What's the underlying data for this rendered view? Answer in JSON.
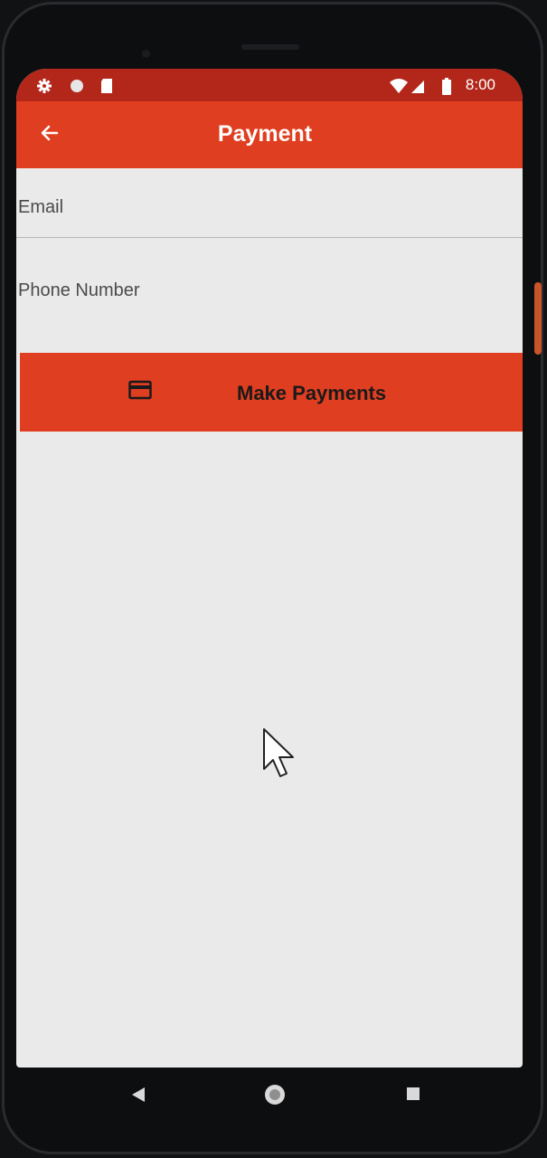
{
  "status_bar": {
    "time": "8:00",
    "icons": [
      "settings-icon",
      "circle-icon",
      "sim-card-icon",
      "wifi-icon",
      "signal-icon",
      "battery-icon"
    ]
  },
  "app_bar": {
    "title": "Payment",
    "back_icon": "arrow-left-icon"
  },
  "form": {
    "email_label": "Email",
    "phone_label": "Phone Number"
  },
  "pay_button": {
    "label": "Make Payments",
    "icon": "credit-card-icon"
  },
  "nav_bar": {
    "buttons": [
      "back-triangle-icon",
      "home-circle-icon",
      "recents-square-icon"
    ]
  },
  "colors": {
    "primary": "#e03e20",
    "primary_dark": "#b3271b",
    "background": "#eaeaea"
  }
}
